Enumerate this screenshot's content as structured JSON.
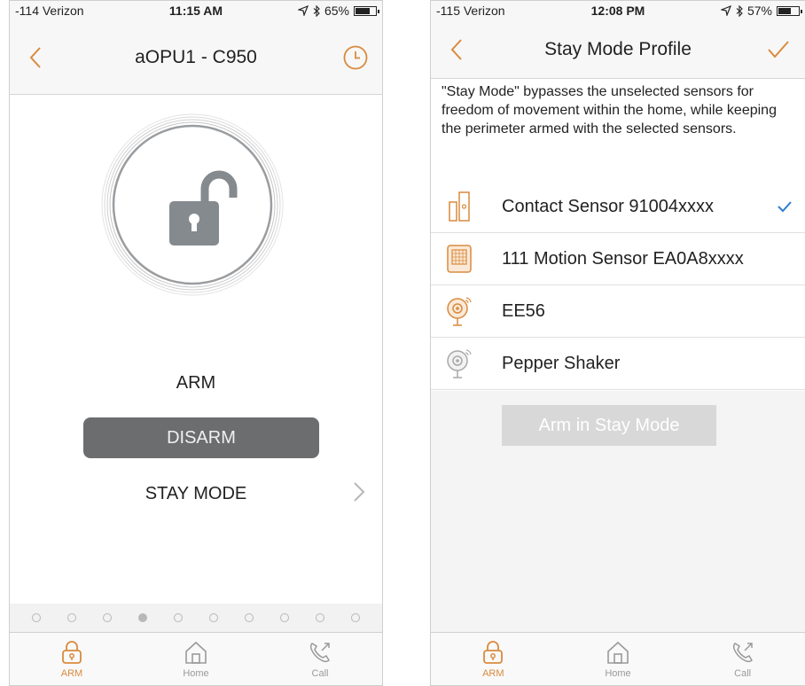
{
  "colors": {
    "accent": "#d98a3d",
    "check": "#2f7fd3",
    "disarm_bg": "#6c6d6f",
    "lock_gray": "#858a8f",
    "disabled_btn": "#d8d8d8"
  },
  "left": {
    "status": {
      "carrier": "-114 Verizon",
      "time": "11:15 AM",
      "battery": "65%",
      "battery_level": 0.65
    },
    "nav": {
      "title": "aOPU1 - C950",
      "back_icon": "chevron-left-icon",
      "right_icon": "clock-icon"
    },
    "lock_icon": "unlocked-padlock-icon",
    "arm_label": "ARM",
    "disarm_label": "DISARM",
    "stay_mode_label": "STAY MODE",
    "pager": {
      "count": 10,
      "active_index": 3
    },
    "tabs": [
      {
        "label": "ARM",
        "icon": "padlock-icon",
        "active": true
      },
      {
        "label": "Home",
        "icon": "home-icon",
        "active": false
      },
      {
        "label": "Call",
        "icon": "phone-call-icon",
        "active": false
      }
    ]
  },
  "right": {
    "status": {
      "carrier": "-115 Verizon",
      "time": "12:08 PM",
      "battery": "57%",
      "battery_level": 0.57
    },
    "nav": {
      "title": "Stay Mode Profile",
      "back_icon": "chevron-left-icon",
      "right_icon": "checkmark-icon"
    },
    "description": "\"Stay Mode\" bypasses the unselected sensors for freedom of movement within the home, while keeping the perimeter armed with the selected sensors.",
    "sensors": [
      {
        "name": "Contact Sensor 91004xxxx",
        "icon": "contact-sensor-icon",
        "selected": true
      },
      {
        "name": "111 Motion Sensor EA0A8xxxx",
        "icon": "motion-sensor-icon",
        "selected": false
      },
      {
        "name": "EE56",
        "icon": "camera-icon",
        "selected": false
      },
      {
        "name": "Pepper Shaker",
        "icon": "camera-icon",
        "selected": false
      }
    ],
    "stay_button_label": "Arm in Stay Mode",
    "tabs": [
      {
        "label": "ARM",
        "icon": "padlock-icon",
        "active": true
      },
      {
        "label": "Home",
        "icon": "home-icon",
        "active": false
      },
      {
        "label": "Call",
        "icon": "phone-call-icon",
        "active": false
      }
    ]
  }
}
